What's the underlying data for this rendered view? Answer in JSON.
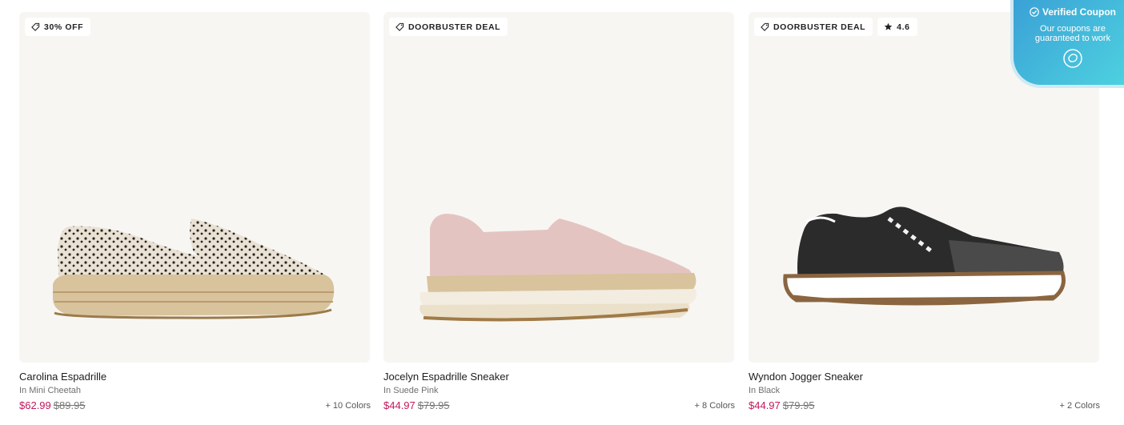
{
  "products": [
    {
      "badges": [
        {
          "icon": "tag-icon",
          "text": "30% OFF"
        }
      ],
      "name": "Carolina Espadrille",
      "variant": "In Mini Cheetah",
      "sale_price": "$62.99",
      "original_price": "$89.95",
      "colors": "+ 10 Colors"
    },
    {
      "badges": [
        {
          "icon": "tag-icon",
          "text": "DOORBUSTER DEAL"
        }
      ],
      "name": "Jocelyn Espadrille Sneaker",
      "variant": "In Suede Pink",
      "sale_price": "$44.97",
      "original_price": "$79.95",
      "colors": "+ 8 Colors"
    },
    {
      "badges": [
        {
          "icon": "tag-icon",
          "text": "DOORBUSTER DEAL"
        },
        {
          "icon": "star-icon",
          "text": "4.6"
        }
      ],
      "name": "Wyndon Jogger Sneaker",
      "variant": "In Black",
      "sale_price": "$44.97",
      "original_price": "$79.95",
      "colors": "+ 2 Colors"
    }
  ],
  "coupon": {
    "title": "Verified Coupon",
    "subtitle": "Our coupons are guaranteed to work"
  },
  "colors": {
    "sale": "#c2185b",
    "card_bg": "#f7f6f3",
    "coupon_gradient_start": "#3aa0d6",
    "coupon_gradient_end": "#4ed3e0"
  }
}
